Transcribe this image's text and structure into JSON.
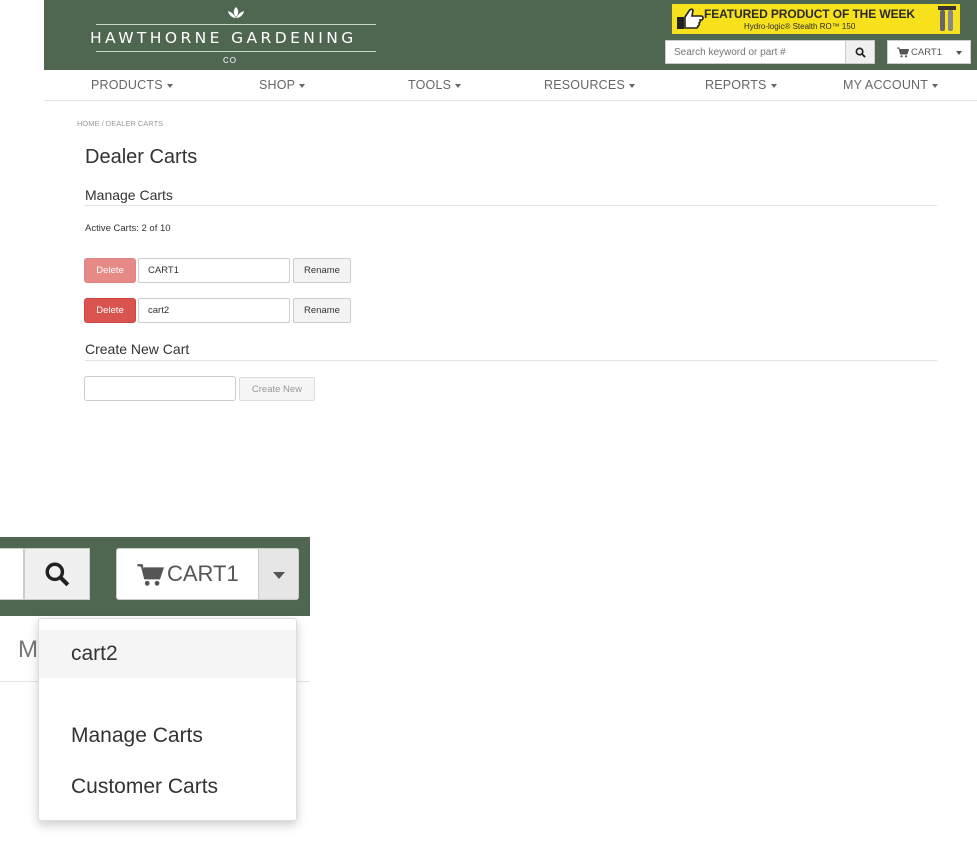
{
  "header": {
    "brand_name": "HAWTHORNE GARDENING",
    "brand_suffix": "CO",
    "featured_title": "FEATURED PRODUCT OF THE WEEK",
    "featured_subtitle": "Hydro-logic® Stealth RO™ 150",
    "search_placeholder": "Search keyword or part #",
    "cart_label": "CART1",
    "colors": {
      "header_bg": "#4f6650",
      "featured_bg": "#f7e11d",
      "danger": "#d9534f"
    }
  },
  "nav": {
    "items": [
      "PRODUCTS",
      "SHOP",
      "TOOLS",
      "RESOURCES",
      "REPORTS",
      "MY ACCOUNT"
    ]
  },
  "breadcrumb": {
    "home": "HOME",
    "separator": "/",
    "current": "DEALER CARTS"
  },
  "page": {
    "title": "Dealer Carts",
    "manage_heading": "Manage Carts",
    "active_carts": "Active Carts: 2 of 10",
    "carts": [
      {
        "delete_label": "Delete",
        "name": "CART1",
        "rename_label": "Rename",
        "delete_enabled": false
      },
      {
        "delete_label": "Delete",
        "name": "cart2",
        "rename_label": "Rename",
        "delete_enabled": true
      }
    ],
    "create_heading": "Create New Cart",
    "new_cart_value": "",
    "create_label": "Create New"
  },
  "zoom": {
    "cart_label": "CART1",
    "nav_partial": "M",
    "menu_items": [
      "cart2",
      "Manage Carts",
      "Customer Carts"
    ]
  }
}
